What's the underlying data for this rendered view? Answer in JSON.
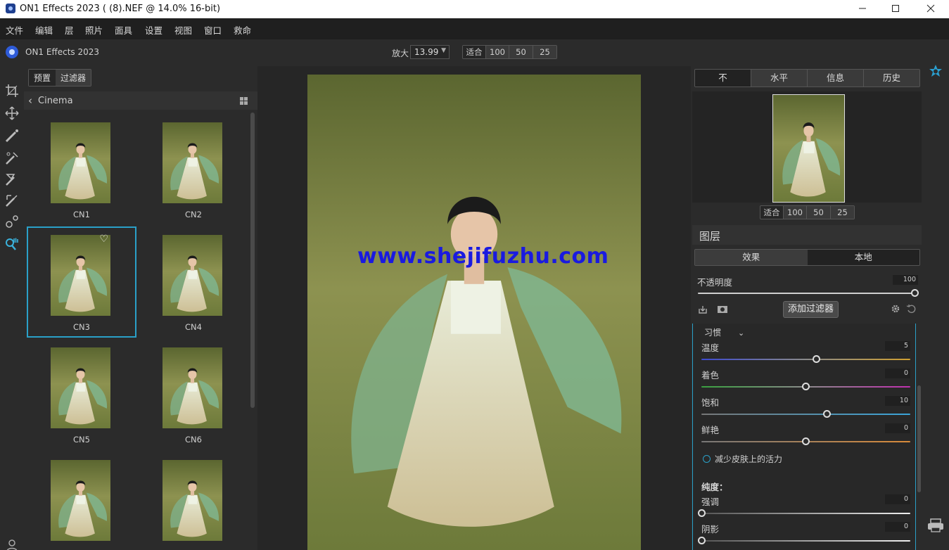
{
  "window": {
    "title": "ON1 Effects 2023 ( (8).NEF @ 14.0% 16-bit)"
  },
  "menubar": {
    "items": [
      "文件",
      "编辑",
      "层",
      "照片",
      "面具",
      "设置",
      "视图",
      "窗口",
      "救命"
    ]
  },
  "app": {
    "name": "ON1 Effects 2023"
  },
  "zoom": {
    "label": "放大",
    "value": "13.99",
    "presets": [
      "适合",
      "100",
      "50",
      "25"
    ]
  },
  "tools": [
    "crop-icon",
    "move-icon",
    "brush-icon",
    "retouch-icon",
    "mask-brush-icon",
    "line-mask-icon",
    "refine-icon",
    "zoom-hand-icon"
  ],
  "left_panel": {
    "tabs": [
      "预置",
      "过滤器"
    ],
    "active_tab": 0,
    "category": "Cinema",
    "presets": [
      {
        "label": "CN1",
        "tone": "muted"
      },
      {
        "label": "CN2",
        "tone": "green"
      },
      {
        "label": "CN3",
        "tone": "bright",
        "selected": true
      },
      {
        "label": "CN4",
        "tone": "dark"
      },
      {
        "label": "CN5",
        "tone": "bright"
      },
      {
        "label": "CN6",
        "tone": "dark"
      },
      {
        "label": "",
        "tone": "bright"
      },
      {
        "label": "",
        "tone": "warm"
      }
    ]
  },
  "watermark": "www.shejifuzhu.com",
  "right_panel": {
    "tabs": [
      "不",
      "水平",
      "信息",
      "历史"
    ],
    "active_tab": 0,
    "nav_zoom": [
      "适合",
      "100",
      "50",
      "25"
    ],
    "layers_title": "图层",
    "layer_modes": [
      "效果",
      "本地"
    ],
    "active_mode": 1,
    "opacity": {
      "label": "不透明度",
      "value": "100",
      "fraction": 1.0
    },
    "add_filter": "添加过滤器",
    "filter": {
      "title": "习惯",
      "sliders": [
        {
          "label": "温度",
          "value": "5",
          "fraction": 0.55,
          "track": "temp"
        },
        {
          "label": "着色",
          "value": "0",
          "fraction": 0.5,
          "track": "tint"
        },
        {
          "label": "饱和",
          "value": "10",
          "fraction": 0.6,
          "track": "sat"
        },
        {
          "label": "鲜艳",
          "value": "0",
          "fraction": 0.5,
          "track": "vib"
        }
      ],
      "skin_option": "减少皮肤上的活力",
      "section": "纯度：",
      "purity": [
        {
          "label": "强调",
          "value": "0",
          "fraction": 0.0
        },
        {
          "label": "阴影",
          "value": "0",
          "fraction": 0.0
        }
      ]
    }
  },
  "colors": {
    "accent": "#2aa0c8",
    "background": "#2b2b2b",
    "watermark": "#1a1ae0"
  }
}
